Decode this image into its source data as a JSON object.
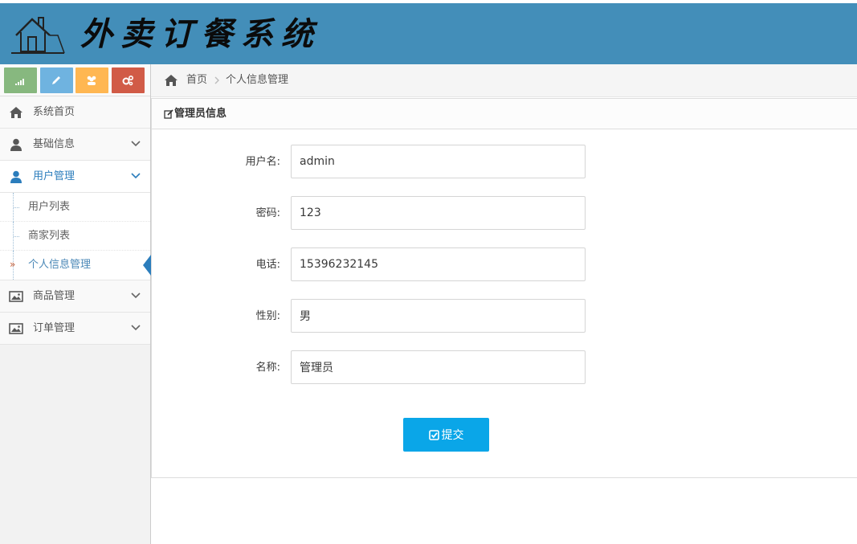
{
  "header": {
    "title": "外卖订餐系统",
    "logo_icon": "house-icon",
    "background_color": "#438eb9"
  },
  "shortcuts": [
    {
      "icon": "signal-icon",
      "color": "#87b87f"
    },
    {
      "icon": "pencil-icon",
      "color": "#6fb3e0"
    },
    {
      "icon": "users-icon",
      "color": "#ffb752"
    },
    {
      "icon": "cogs-icon",
      "color": "#d15b47"
    }
  ],
  "sidebar": {
    "items": [
      {
        "label": "系统首页",
        "icon": "home-icon"
      },
      {
        "label": "基础信息",
        "icon": "user-icon"
      },
      {
        "label": "用户管理",
        "icon": "user-icon",
        "children": [
          {
            "label": "用户列表"
          },
          {
            "label": "商家列表"
          },
          {
            "label": "个人信息管理",
            "active": true
          }
        ]
      },
      {
        "label": "商品管理",
        "icon": "picture-icon"
      },
      {
        "label": "订单管理",
        "icon": "picture-icon"
      }
    ]
  },
  "breadcrumb": {
    "home": "首页",
    "current": "个人信息管理"
  },
  "panel": {
    "title": "管理员信息"
  },
  "form": {
    "fields": [
      {
        "label": "用户名:",
        "value": "admin"
      },
      {
        "label": "密码:",
        "value": "123"
      },
      {
        "label": "电话:",
        "value": "15396232145"
      },
      {
        "label": "性别:",
        "value": "男"
      },
      {
        "label": "名称:",
        "value": "管理员"
      }
    ],
    "submit_label": "提交",
    "submit_color": "#0aa6e8"
  }
}
